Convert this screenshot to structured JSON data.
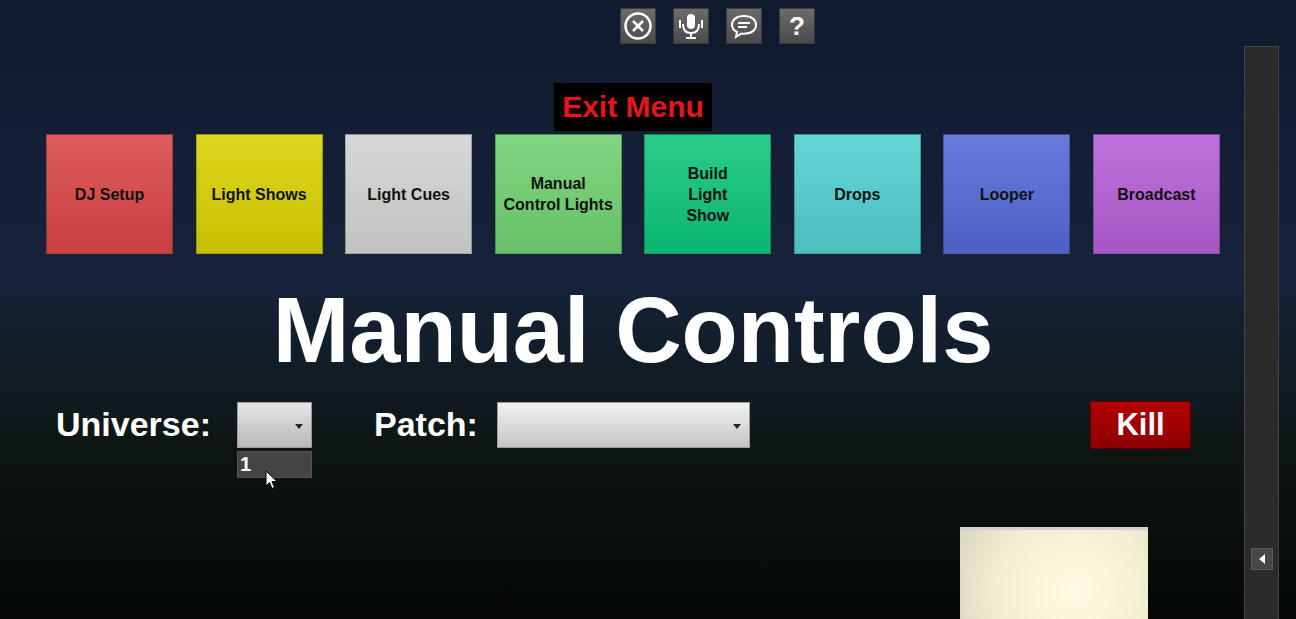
{
  "toolbar": {
    "help": "?"
  },
  "exit_menu": "Exit Menu",
  "tiles": [
    {
      "lines": [
        "DJ Setup"
      ],
      "color": "#d94545"
    },
    {
      "lines": [
        "Light Shows"
      ],
      "color": "#d8d000"
    },
    {
      "lines": [
        "Light Cues"
      ],
      "color": "#d2d2d2"
    },
    {
      "lines": [
        "Manual",
        "Control Lights"
      ],
      "color": "#6fd06f"
    },
    {
      "lines": [
        "Build",
        "Light",
        "Show"
      ],
      "color": "#0cc57a"
    },
    {
      "lines": [
        "Drops"
      ],
      "color": "#4fcfcf"
    },
    {
      "lines": [
        "Looper"
      ],
      "color": "#5468d6"
    },
    {
      "lines": [
        "Broadcast"
      ],
      "color": "#b45ed6"
    }
  ],
  "title": "Manual Controls",
  "universe": {
    "label": "Universe:",
    "value": "",
    "expanded": true,
    "options": [
      {
        "label": "1",
        "highlighted": true
      }
    ]
  },
  "patch": {
    "label": "Patch:",
    "value": "",
    "expanded": false
  },
  "kill_button": "Kill"
}
